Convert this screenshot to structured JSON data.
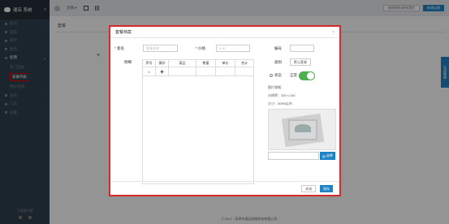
{
  "app": {
    "brand": "速店 系统",
    "menu_icon": "≡"
  },
  "topbar": {
    "user": "店铺 ▾",
    "right_buttons": [
      "修改密码/联系我们",
      "新增店铺"
    ]
  },
  "sidebar": {
    "items": [
      {
        "label": "首页",
        "icon": "home-icon"
      },
      {
        "label": "菜品",
        "icon": "dish-icon"
      },
      {
        "label": "库存",
        "icon": "stock-icon"
      },
      {
        "label": "财务",
        "icon": "finance-icon"
      },
      {
        "label": "促销",
        "icon": "promo-icon",
        "active": true
      }
    ],
    "subitems": [
      "热门活动",
      "套餐列表",
      "特价活动"
    ],
    "more_items": [
      {
        "label": "会员"
      },
      {
        "label": "门店"
      },
      {
        "label": "设置"
      }
    ],
    "footer": "下载客户端"
  },
  "content": {
    "tab": "套餐",
    "plus": "+",
    "footer": "© 2017 - 深圳市速店网络科技有限公司"
  },
  "side_tab": "在线客服",
  "modal": {
    "title": "套餐档案",
    "close": "×",
    "name_label": "套名",
    "name_placeholder": "套餐名称",
    "price_label": "价格",
    "price_placeholder": "0.00",
    "detail_label": "明细",
    "table_headers": [
      "序号",
      "操作",
      "菜品",
      "数量",
      "单价",
      "合计"
    ],
    "table_row": {
      "index": "1",
      "add": "+"
    },
    "code_label": "编号",
    "type_label": "类别",
    "type_button": "默认套餐",
    "status_label": "状态",
    "status_text": "正常",
    "image_title": "图片规格：",
    "image_size": "分辨率：320 x 240",
    "image_max": "大小：50KB以内",
    "choose_button": "选择",
    "close_button": "关闭",
    "save_button": "保存"
  }
}
